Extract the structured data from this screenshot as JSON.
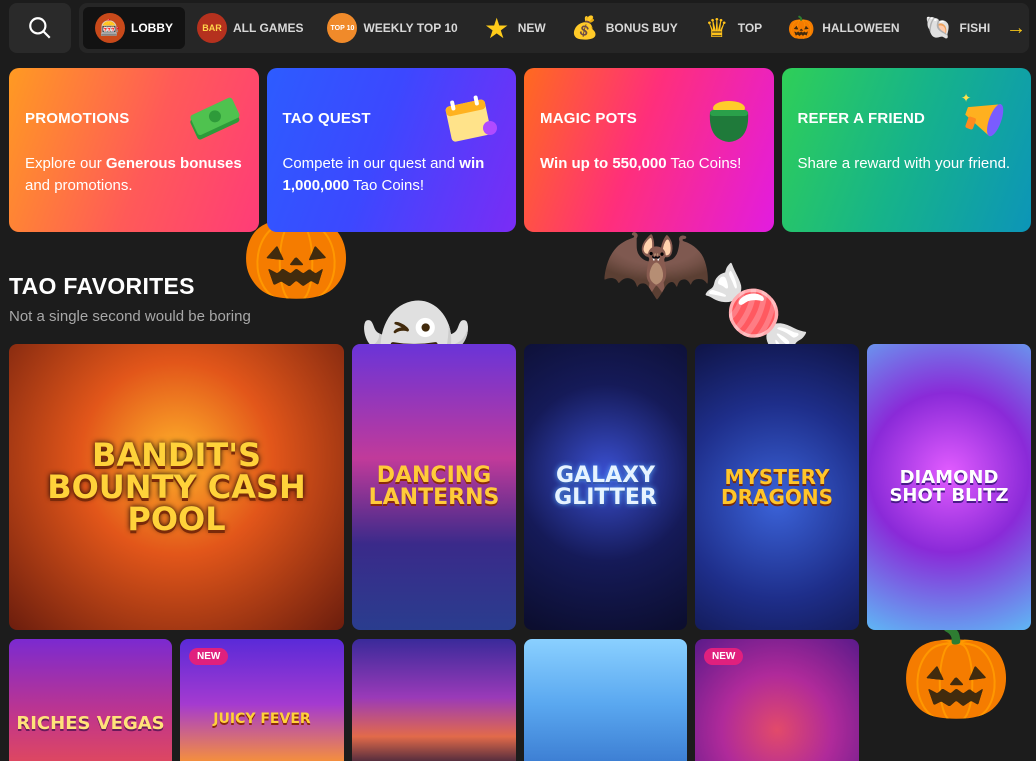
{
  "nav": {
    "items": [
      {
        "label": "LOBBY",
        "icon": "slot-machine-icon",
        "glyph": "🎰"
      },
      {
        "label": "ALL GAMES",
        "icon": "bar-icon",
        "glyph": "BAR"
      },
      {
        "label": "WEEKLY TOP 10",
        "icon": "top10-icon",
        "glyph": "TOP 10"
      },
      {
        "label": "NEW",
        "icon": "star-icon",
        "glyph": "★"
      },
      {
        "label": "BONUS BUY",
        "icon": "money-bag-icon",
        "glyph": "💰"
      },
      {
        "label": "TOP",
        "icon": "crown-icon",
        "glyph": "♛"
      },
      {
        "label": "HALLOWEEN",
        "icon": "pumpkin-icon",
        "glyph": "🎃"
      },
      {
        "label": "FISHI",
        "icon": "shell-icon",
        "glyph": "🐚"
      }
    ],
    "next_glyph": "→"
  },
  "promos": [
    {
      "title": "PROMOTIONS",
      "desc_pre": "Explore our ",
      "desc_bold": "Generous bonuses",
      "desc_post": " and promotions.",
      "icon": "cash-stack-icon"
    },
    {
      "title": "TAO QUEST",
      "desc_pre": "Compete in our quest and ",
      "desc_bold": "win 1,000,000",
      "desc_post": " Tao Coins!",
      "icon": "calendar-icon"
    },
    {
      "title": "MAGIC POTS",
      "desc_pre": "",
      "desc_bold": "Win up to 550,000",
      "desc_post": " Tao Coins!",
      "icon": "pot-of-gold-icon"
    },
    {
      "title": "REFER A FRIEND",
      "desc_pre": "Share a reward with your friend.",
      "desc_bold": "",
      "desc_post": "",
      "icon": "megaphone-icon"
    }
  ],
  "section": {
    "title": "TAO FAVORITES",
    "subtitle": "Not a single second would be boring"
  },
  "games": [
    {
      "title": "BANDIT'S BOUNTY CASH POOL",
      "badge": ""
    },
    {
      "title": "DANCING LANTERNS",
      "badge": ""
    },
    {
      "title": "GALAXY GLITTER",
      "badge": ""
    },
    {
      "title": "MYSTERY DRAGONS",
      "badge": ""
    },
    {
      "title": "DIAMOND SHOT BLITZ",
      "badge": ""
    },
    {
      "title": "RICHES VEGAS",
      "badge": ""
    },
    {
      "title": "JUICY FEVER",
      "badge": "NEW"
    },
    {
      "title": "",
      "badge": ""
    },
    {
      "title": "",
      "badge": ""
    },
    {
      "title": "",
      "badge": "NEW"
    }
  ]
}
